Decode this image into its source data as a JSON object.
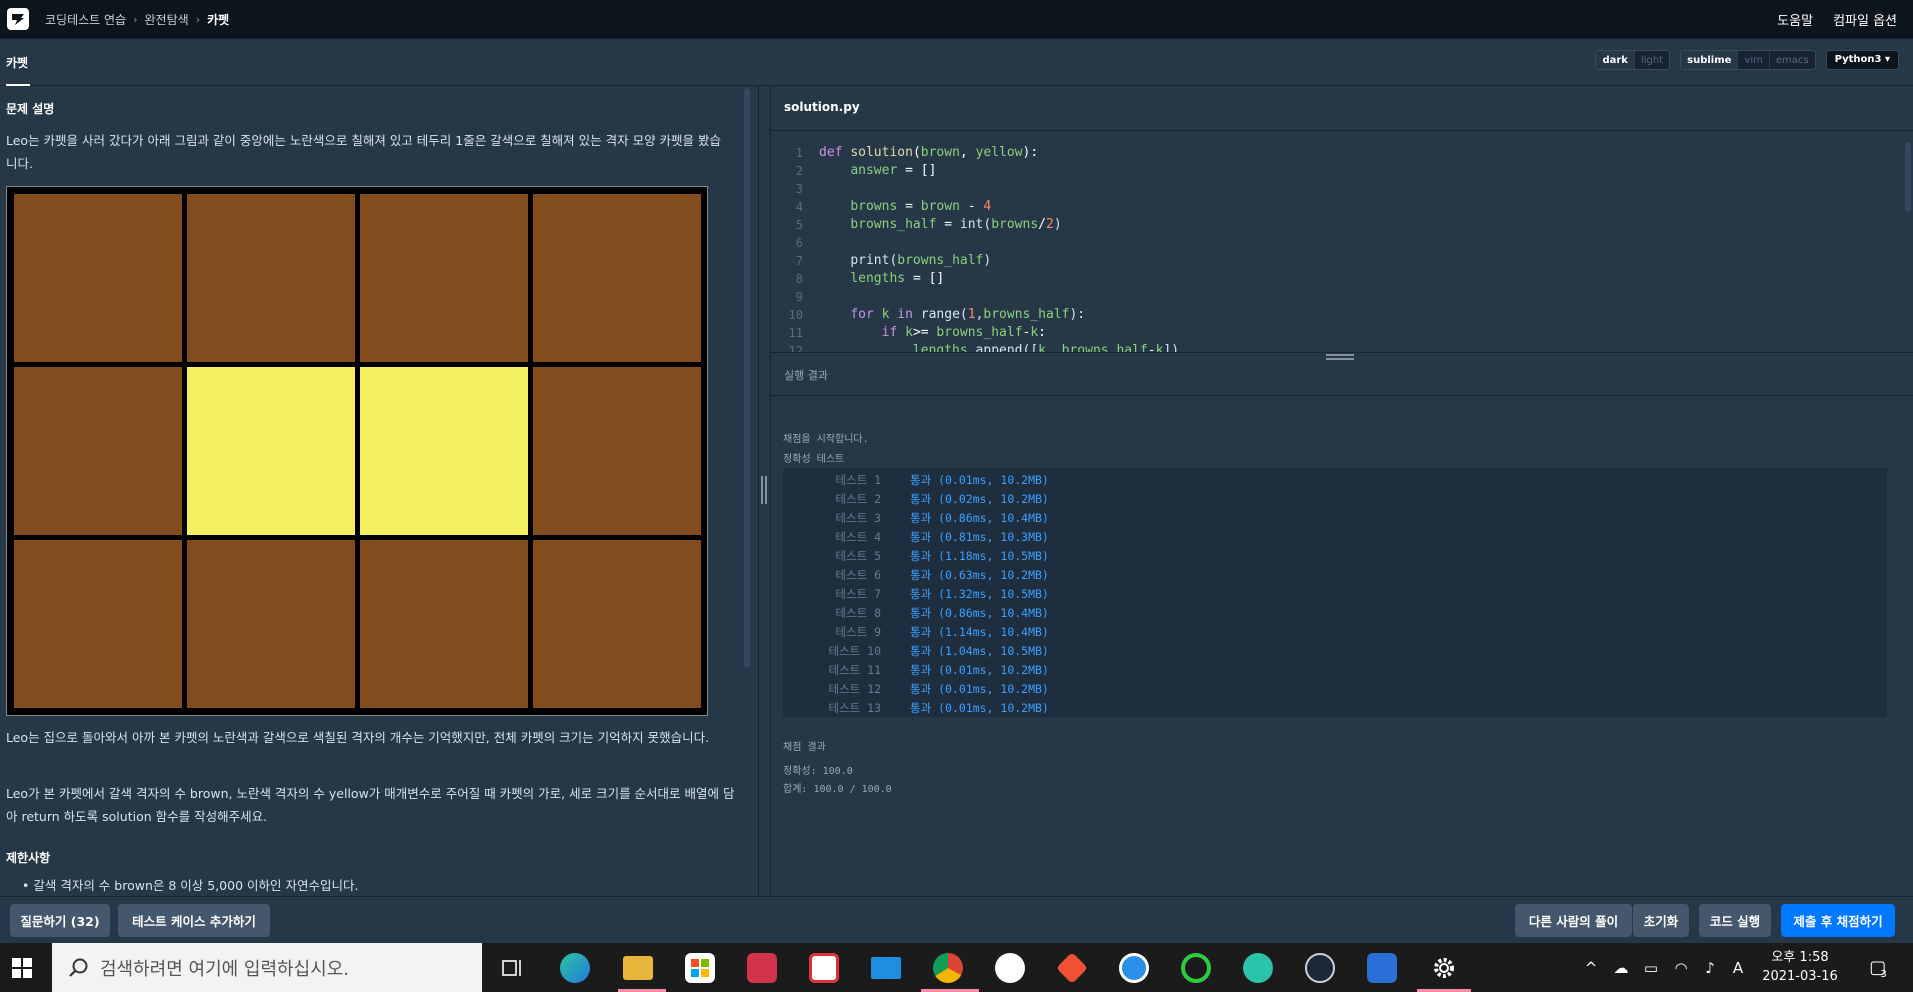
{
  "breadcrumb": {
    "items": [
      "코딩테스트 연습",
      "완전탐색"
    ],
    "current": "카펫"
  },
  "top_links": [
    "도움말",
    "컴파일 옵션"
  ],
  "subbar": {
    "tab_title": "카펫",
    "theme_options": [
      "dark",
      "light"
    ],
    "editor_options": [
      "sublime",
      "vim",
      "emacs"
    ],
    "language": "Python3"
  },
  "problem": {
    "section_title": "문제 설명",
    "para1": "Leo는 카펫을 사러 갔다가 아래 그림과 같이 중앙에는 노란색으로 칠해져 있고 테두리 1줄은 갈색으로 칠해져 있는 격자 모양 카펫을 봤습니다.",
    "para2": "Leo는 집으로 돌아와서 아까 본 카펫의 노란색과 갈색으로 색칠된 격자의 개수는 기억했지만, 전체 카펫의 크기는 기억하지 못했습니다.",
    "para3": "Leo가 본 카펫에서 갈색 격자의 수 brown, 노란색 격자의 수 yellow가 매개변수로 주어질 때 카펫의 가로, 세로 크기를 순서대로 배열에 담아 return 하도록 solution 함수를 작성해주세요.",
    "constraints_title": "제한사항",
    "constraint1": "갈색 격자의 수 brown은 8 이상 5,000 이하인 자연수입니다."
  },
  "carpet_grid": {
    "cols": 4,
    "rows": 3,
    "cells": [
      "brown",
      "brown",
      "brown",
      "brown",
      "brown",
      "yellow",
      "yellow",
      "brown",
      "brown",
      "brown",
      "brown",
      "brown"
    ],
    "colors": {
      "brown": "#834c1f",
      "yellow": "#f2ef60"
    }
  },
  "editor": {
    "filename": "solution.py",
    "line_numbers": [
      "1",
      "2",
      "3",
      "4",
      "5",
      "6",
      "7",
      "8",
      "9",
      "10",
      "11",
      "12"
    ]
  },
  "output": {
    "title": "실행 결과",
    "start_msg": "채점을 시작합니다.",
    "section_labels": [
      "정확성",
      "테스트"
    ],
    "tests": [
      {
        "name": "테스트 1",
        "result": "통과 (0.01ms, 10.2MB)"
      },
      {
        "name": "테스트 2",
        "result": "통과 (0.02ms, 10.2MB)"
      },
      {
        "name": "테스트 3",
        "result": "통과 (0.86ms, 10.4MB)"
      },
      {
        "name": "테스트 4",
        "result": "통과 (0.81ms, 10.3MB)"
      },
      {
        "name": "테스트 5",
        "result": "통과 (1.18ms, 10.5MB)"
      },
      {
        "name": "테스트 6",
        "result": "통과 (0.63ms, 10.2MB)"
      },
      {
        "name": "테스트 7",
        "result": "통과 (1.32ms, 10.5MB)"
      },
      {
        "name": "테스트 8",
        "result": "통과 (0.86ms, 10.4MB)"
      },
      {
        "name": "테스트 9",
        "result": "통과 (1.14ms, 10.4MB)"
      },
      {
        "name": "테스트 10",
        "result": "통과 (1.04ms, 10.5MB)"
      },
      {
        "name": "테스트 11",
        "result": "통과 (0.01ms, 10.2MB)"
      },
      {
        "name": "테스트 12",
        "result": "통과 (0.01ms, 10.2MB)"
      },
      {
        "name": "테스트 13",
        "result": "통과 (0.01ms, 10.2MB)"
      }
    ],
    "grading_title": "채점 결과",
    "accuracy": "정확성: 100.0",
    "total": "합계: 100.0 / 100.0"
  },
  "footer": {
    "questions_button": "질문하기 (32)",
    "add_testcase_button": "테스트 케이스 추가하기",
    "others_solution_button": "다른 사람의 풀이",
    "reset_button": "초기화",
    "run_button": "코드 실행",
    "submit_button": "제출 후 채점하기"
  },
  "taskbar": {
    "search_placeholder": "검색하려면 여기에 입력하십시오.",
    "time": "오후 1:58",
    "date": "2021-03-16",
    "notification_count": "3",
    "ime_label": "A"
  }
}
